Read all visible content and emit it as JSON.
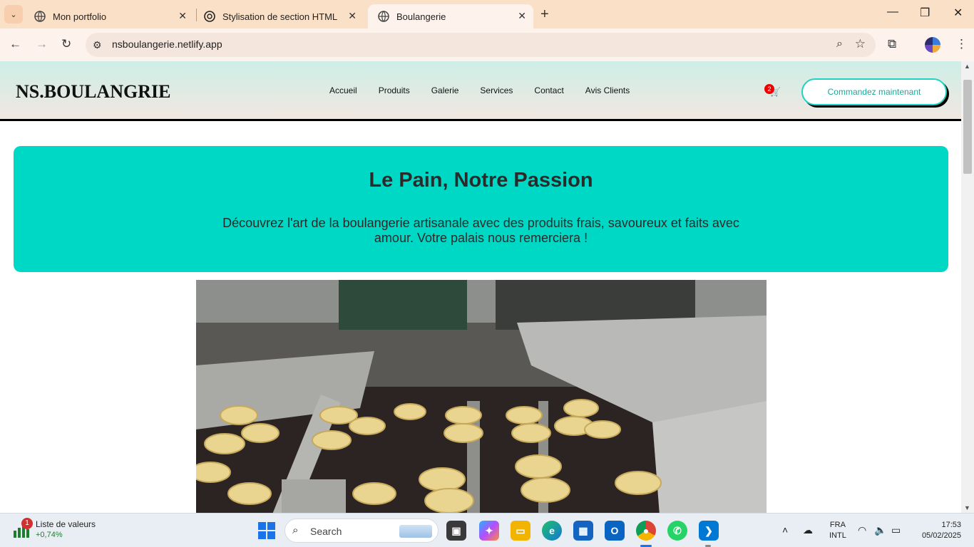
{
  "browser": {
    "tabs": [
      {
        "title": "Mon portfolio",
        "active": false
      },
      {
        "title": "Stylisation de section HTML",
        "active": false
      },
      {
        "title": "Boulangerie",
        "active": true
      }
    ],
    "url": "nsboulangerie.netlify.app"
  },
  "site": {
    "logo": "NS.BOULANGRIE",
    "nav": [
      "Accueil",
      "Produits",
      "Galerie",
      "Services",
      "Contact",
      "Avis Clients"
    ],
    "cart_count": "2",
    "cta": "Commandez maintenant",
    "hero": {
      "title": "Le Pain, Notre Passion",
      "text": "Découvrez l'art de la boulangerie artisanale avec des produits frais, savoureux et faits avec amour. Votre palais nous remerciera !"
    }
  },
  "taskbar": {
    "widget_badge": "1",
    "widget_title": "Liste de valeurs",
    "widget_value": "+0,74%",
    "search_label": "Search",
    "lang_1": "FRA",
    "lang_2": "INTL",
    "time": "17:53",
    "date": "05/02/2025"
  },
  "colors": {
    "hero_bg": "#00d8c6",
    "cta_border": "#1fd3c0",
    "tabstrip": "#fbe0c8"
  }
}
